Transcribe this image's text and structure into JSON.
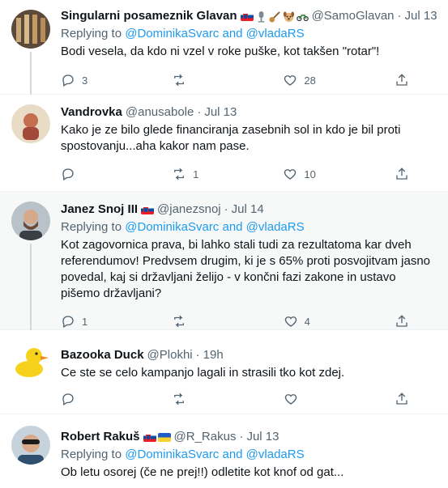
{
  "tweets": [
    {
      "name": "Singularni posameznik Glavan",
      "handle": "@SamoGlavan",
      "time": "Jul 13",
      "replying_prefix": "Replying to",
      "replying_users": "@DominikaSvarc and @vladaRS",
      "text": "Bodi vesela, da kdo ni vzel v roke puške, kot takšen \"rotar\"!",
      "replies": "3",
      "retweets": "",
      "likes": "28",
      "flags": [
        "flag-si",
        "microphone-emoji",
        "guitar-emoji",
        "dog-emoji",
        "motorcycle-emoji"
      ]
    },
    {
      "name": "Vandrovka",
      "handle": "@anusabole",
      "time": "Jul 13",
      "text": "Kako je ze bilo glede financiranja zasebnih sol in kdo je bil proti spostovanju...aha kakor nam pase.",
      "replies": "",
      "retweets": "1",
      "likes": "10"
    },
    {
      "name": "Janez Snoj III",
      "handle": "@janezsnoj",
      "time": "Jul 14",
      "replying_prefix": "Replying to",
      "replying_users": "@DominikaSvarc and @vladaRS",
      "text": "Kot zagovornica prava, bi lahko stali tudi za rezultatoma kar dveh referendumov! Predvsem drugim, ki je s 65% proti posvojitvam jasno povedal, kaj si državljani želijo - v končni fazi zakone in ustavo pišemo državljani?",
      "replies": "1",
      "retweets": "",
      "likes": "4",
      "flags": [
        "flag-si"
      ]
    },
    {
      "name": "Bazooka Duck",
      "handle": "@Plokhi",
      "time": "19h",
      "text": "Ce ste se celo kampanjo lagali in strasili tko kot zdej.",
      "replies": "",
      "retweets": "",
      "likes": ""
    },
    {
      "name": "Robert Rakuš",
      "handle": "@R_Rakus",
      "time": "Jul 13",
      "replying_prefix": "Replying to",
      "replying_users": "@DominikaSvarc and @vladaRS",
      "text": "Ob letu osorej (če ne prej!!) odletite kot knof od gat...",
      "flags": [
        "flag-si",
        "flag-ua"
      ]
    }
  ],
  "colors": {
    "link": "#1d9bf0",
    "secondary": "#536471",
    "thread": "#cfd9de"
  }
}
